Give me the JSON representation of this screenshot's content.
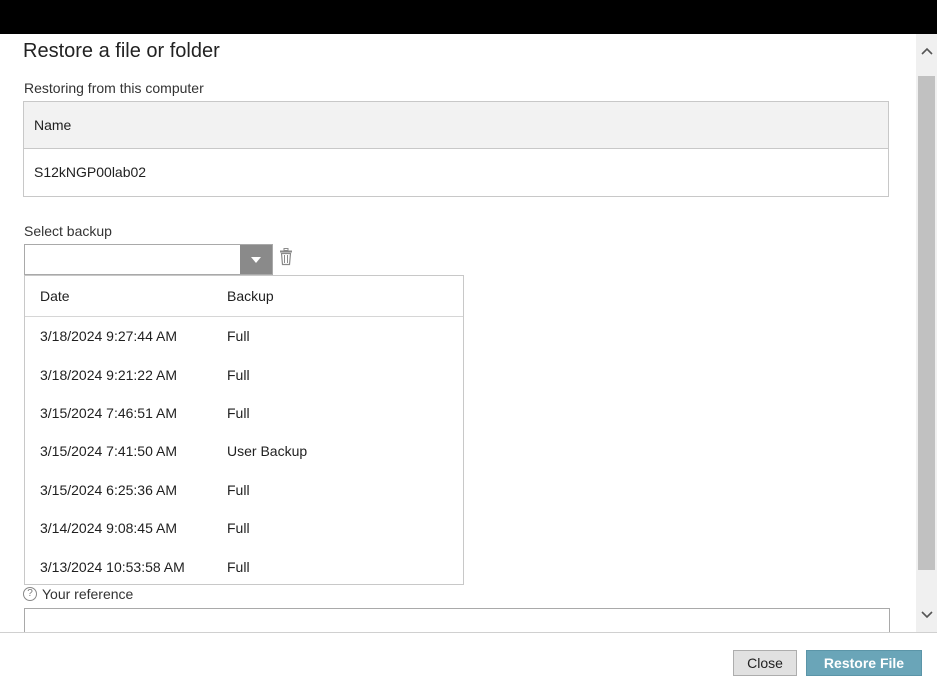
{
  "dialog": {
    "title": "Restore a file or folder",
    "subtitle": "Restoring from this computer"
  },
  "computer_table": {
    "header": "Name",
    "rows": [
      "S12kNGP00lab02"
    ]
  },
  "backup_select": {
    "label": "Select backup",
    "value": "",
    "columns": [
      "Date",
      "Backup"
    ],
    "options": [
      {
        "date": "3/18/2024 9:27:44 AM",
        "type": "Full"
      },
      {
        "date": "3/18/2024 9:21:22 AM",
        "type": "Full"
      },
      {
        "date": "3/15/2024 7:46:51 AM",
        "type": "Full"
      },
      {
        "date": "3/15/2024 7:41:50 AM",
        "type": "User Backup"
      },
      {
        "date": "3/15/2024 6:25:36 AM",
        "type": "Full"
      },
      {
        "date": "3/14/2024 9:08:45 AM",
        "type": "Full"
      },
      {
        "date": "3/13/2024 10:53:58 AM",
        "type": "Full"
      }
    ]
  },
  "reference": {
    "label": "Your reference",
    "value": "",
    "help_icon": "?"
  },
  "footer": {
    "close_label": "Close",
    "restore_label": "Restore File"
  },
  "icons": {
    "dropdown": "chevron-down-icon",
    "delete": "trash-icon",
    "help": "question-circle-icon",
    "scroll_up": "chevron-up-icon",
    "scroll_down": "chevron-down-icon"
  },
  "colors": {
    "restore_button": "#6aa5b8",
    "combo_button": "#8a8a8a"
  }
}
